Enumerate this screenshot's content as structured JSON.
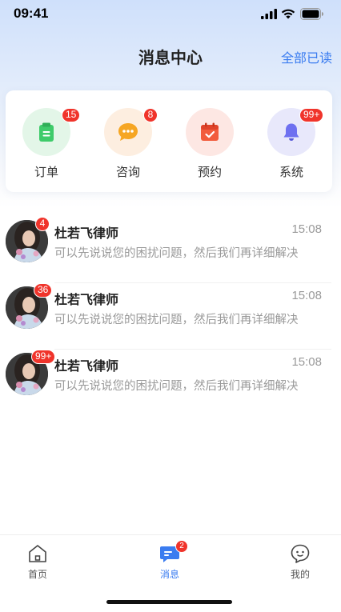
{
  "status_bar": {
    "time": "09:41"
  },
  "header": {
    "title": "消息中心",
    "action": "全部已读"
  },
  "categories": [
    {
      "label": "订单",
      "badge": "15",
      "icon": "order-clipboard-icon",
      "color": "#3ecb6a",
      "bg": "#e3f6e8"
    },
    {
      "label": "咨询",
      "badge": "8",
      "icon": "consult-chat-icon",
      "color": "#f6a623",
      "bg": "#fdeee0"
    },
    {
      "label": "预约",
      "badge": "",
      "icon": "appointment-calendar-icon",
      "color": "#f25c3c",
      "bg": "#fde7e3"
    },
    {
      "label": "系统",
      "badge": "99+",
      "icon": "system-bell-icon",
      "color": "#6e70f0",
      "bg": "#e8e8fb"
    }
  ],
  "messages": [
    {
      "name": "杜若飞律师",
      "time": "15:08",
      "preview": "可以先说说您的困扰问题，然后我们再详细解决",
      "badge": "4"
    },
    {
      "name": "杜若飞律师",
      "time": "15:08",
      "preview": "可以先说说您的困扰问题，然后我们再详细解决",
      "badge": "36"
    },
    {
      "name": "杜若飞律师",
      "time": "15:08",
      "preview": "可以先说说您的困扰问题，然后我们再详细解决",
      "badge": "99+"
    }
  ],
  "tabs": [
    {
      "label": "首页",
      "icon": "home-icon",
      "active": false
    },
    {
      "label": "消息",
      "icon": "message-icon",
      "active": true,
      "badge": "2"
    },
    {
      "label": "我的",
      "icon": "profile-icon",
      "active": false
    }
  ],
  "colors": {
    "accent": "#3a7cf0",
    "badge": "#f0342b"
  }
}
